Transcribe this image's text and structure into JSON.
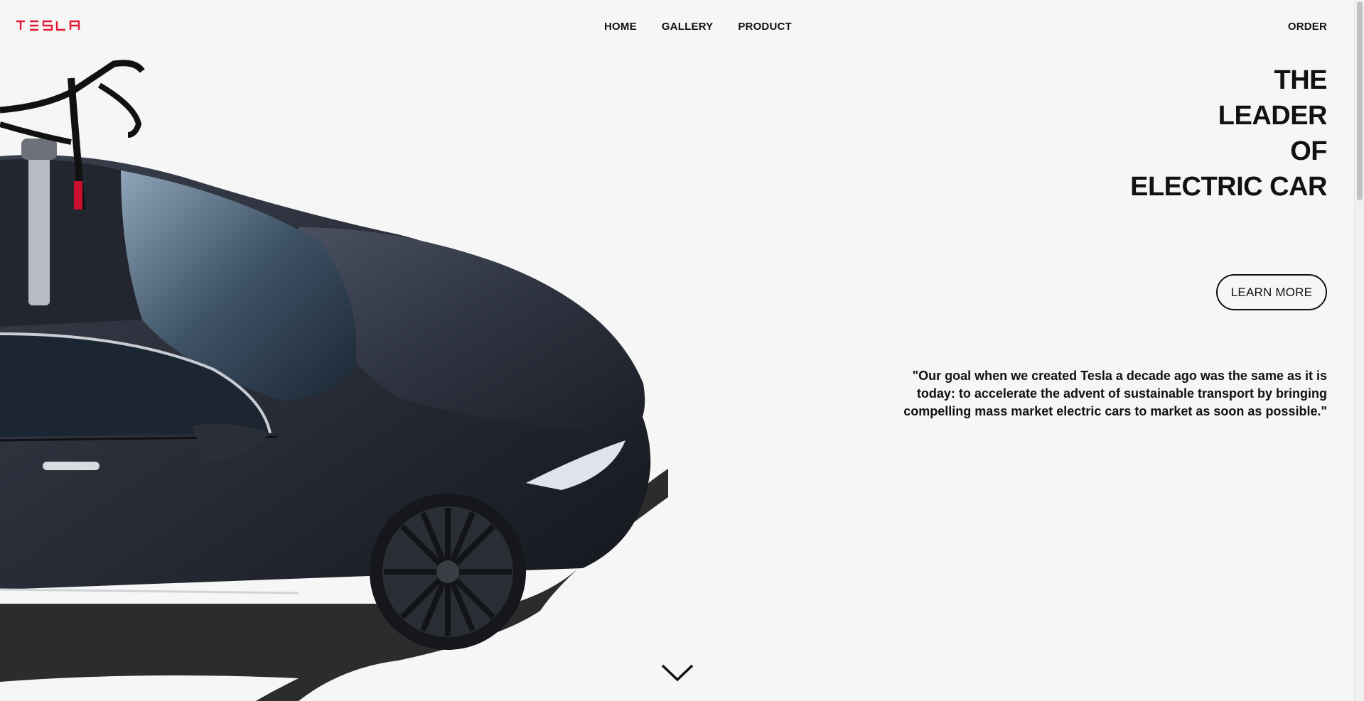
{
  "brand": {
    "logo_text": "TESLA",
    "logo_color": "#e31937"
  },
  "nav": {
    "items": [
      {
        "label": "HOME"
      },
      {
        "label": "GALLERY"
      },
      {
        "label": "PRODUCT"
      }
    ],
    "order_label": "ORDER"
  },
  "hero": {
    "headline_lines": [
      "THE",
      "LEADER",
      "OF",
      "ELECTRIC CAR"
    ],
    "cta_label": "LEARN MORE",
    "quote": "\"Our goal when we created Tesla a decade ago was the same as it is today: to accelerate the advent of sustainable transport by bringing compelling mass market electric cars to market as soon as possible.\"",
    "scroll_icon": "chevron-down-icon",
    "image_subject": "car-photo"
  },
  "colors": {
    "background": "#f6f6f6",
    "text": "#111111",
    "car_body": "#2b2f3a"
  }
}
